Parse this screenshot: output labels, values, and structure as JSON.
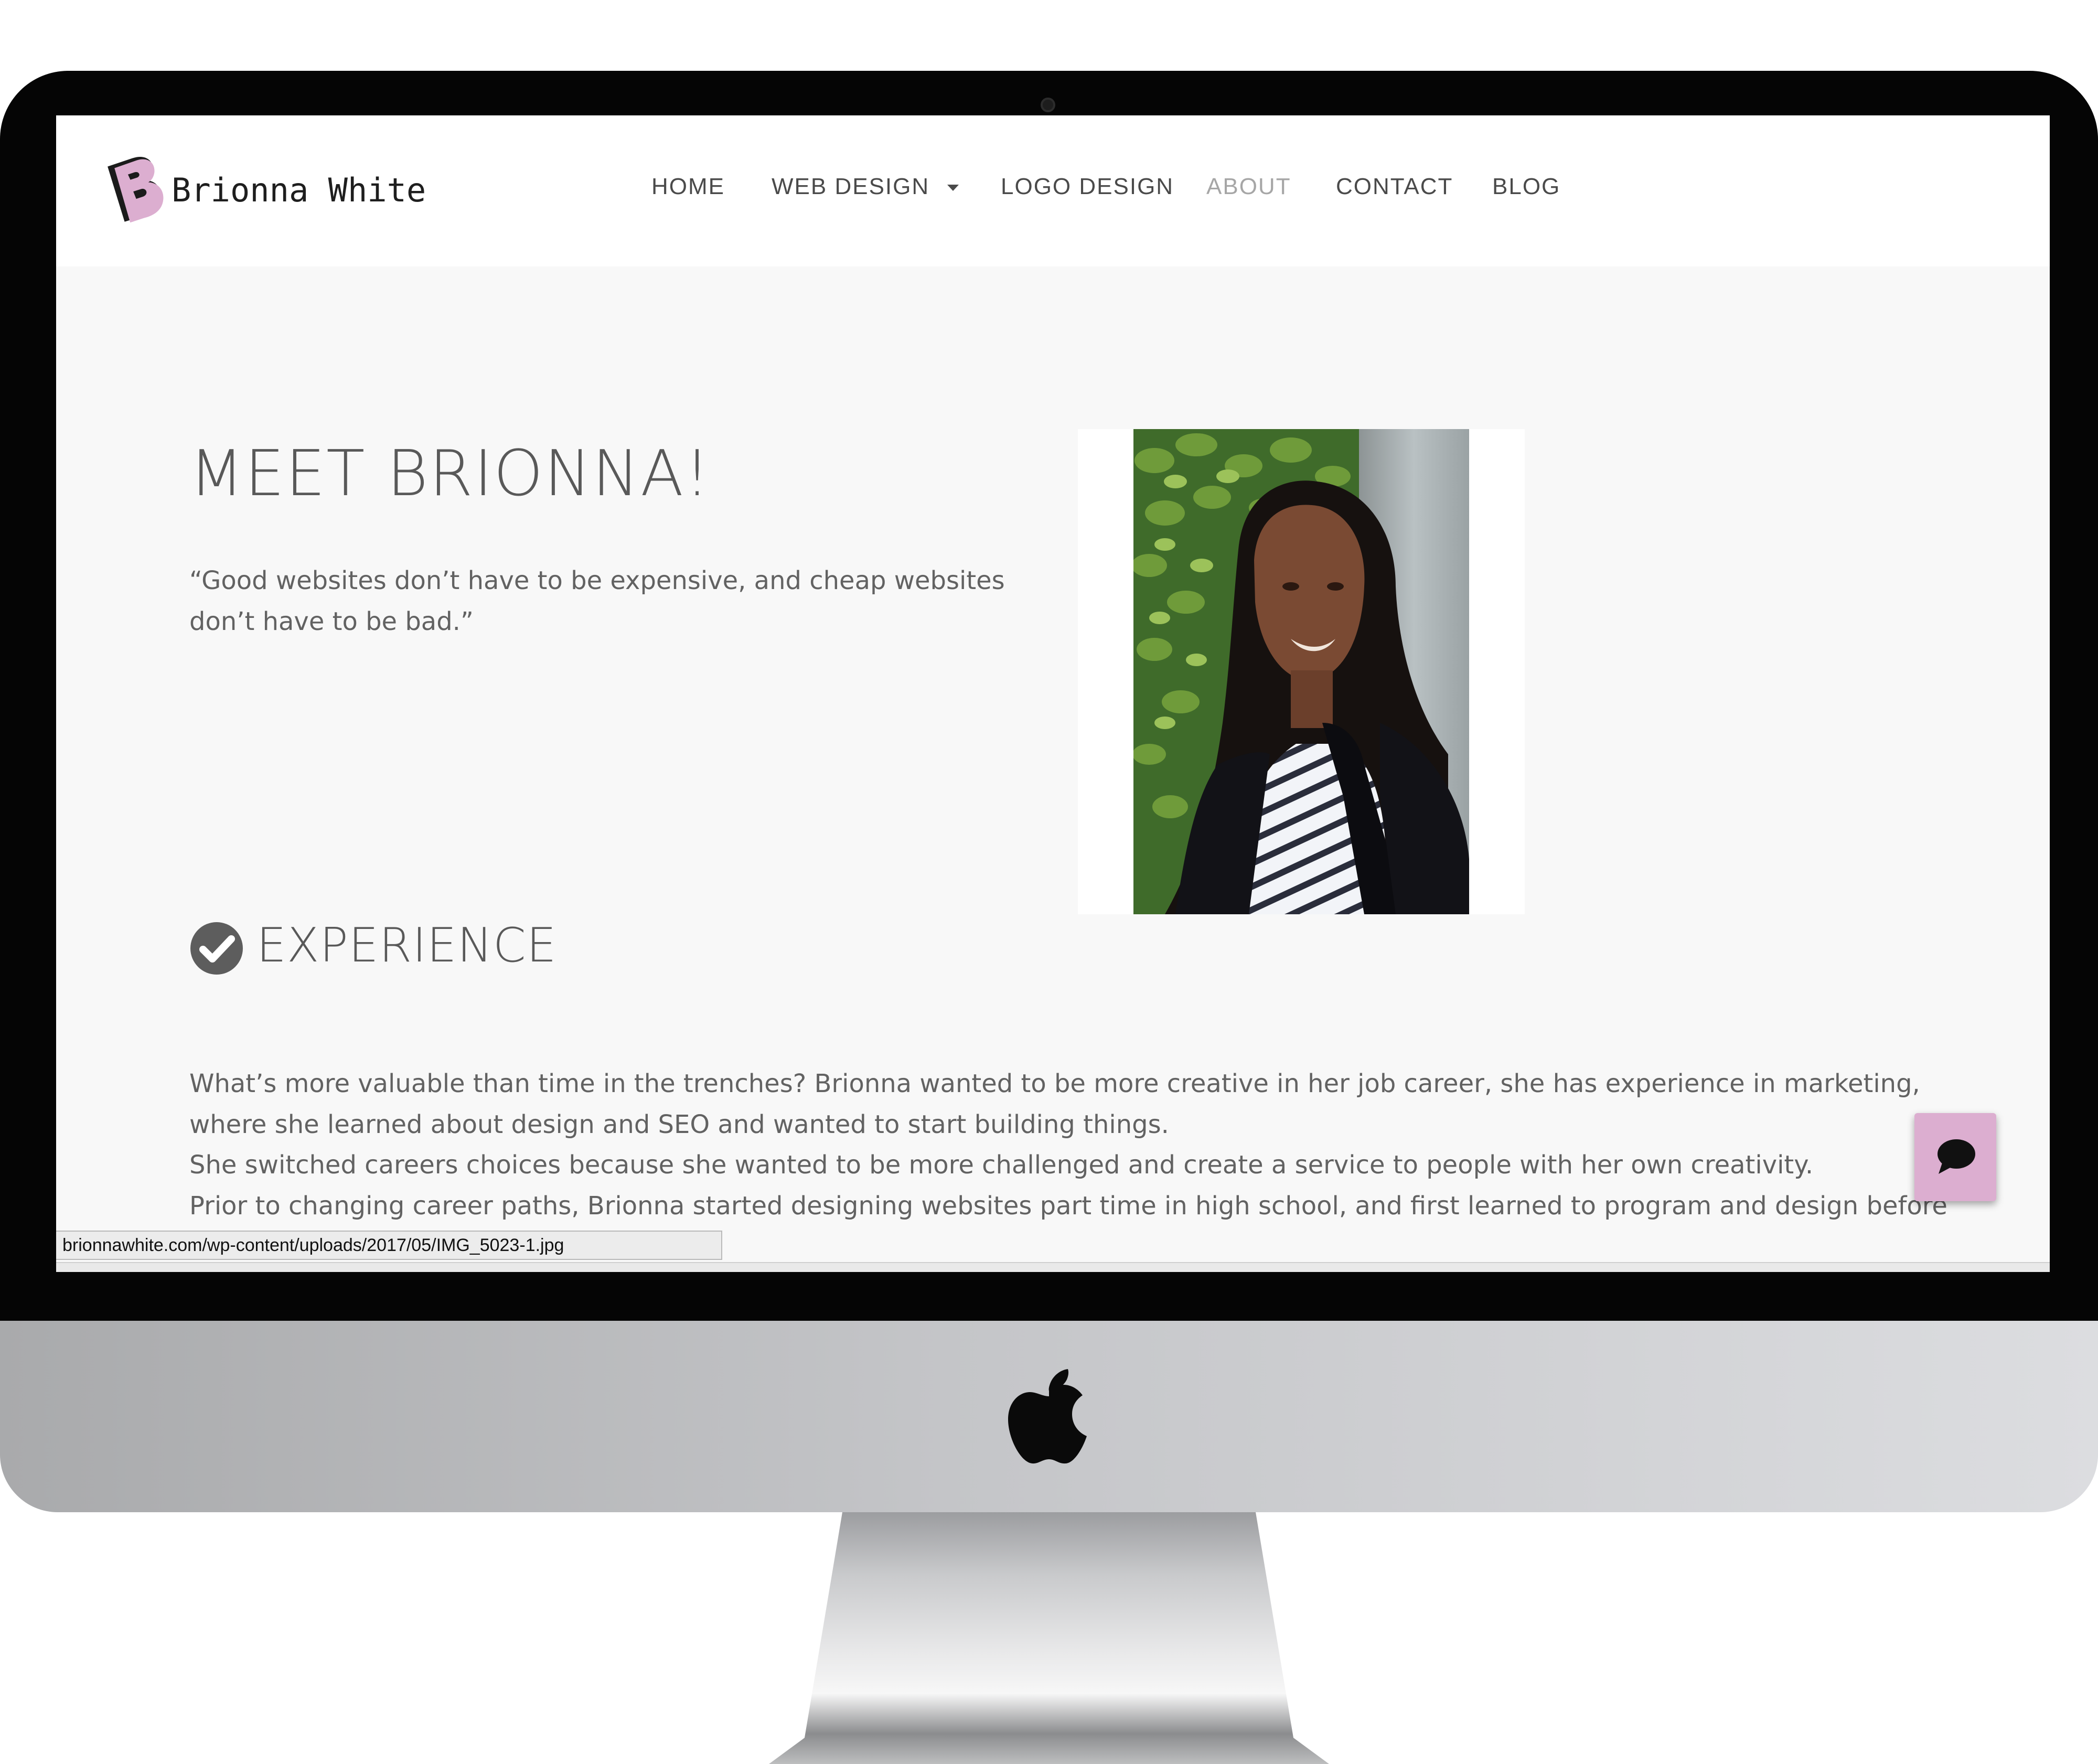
{
  "brand": {
    "name": "Brionna White",
    "logo_letter": "B",
    "accent_color": "#dcaed0"
  },
  "nav": {
    "items": [
      {
        "label": "HOME"
      },
      {
        "label": "WEB DESIGN"
      },
      {
        "label": "LOGO DESIGN"
      },
      {
        "label": "ABOUT"
      },
      {
        "label": "CONTACT"
      },
      {
        "label": "BLOG"
      }
    ],
    "active": "ABOUT"
  },
  "hero": {
    "title": "MEET BRIONNA!",
    "quote_line1": "“Good websites don’t have to be expensive, and cheap websites",
    "quote_line2": "don’t have to be bad.”"
  },
  "experience": {
    "heading": "EXPERIENCE",
    "icon": "check-circle-icon",
    "lines": [
      "What’s more valuable than time in the trenches? Brionna wanted to be more creative in her job career, she has experience in marketing,",
      "where she learned about design and SEO and wanted to start building things.",
      "She switched careers choices because she wanted to be more challenged and create a service to people with her own creativity.",
      "Prior to changing career paths, Brionna started designing websites part time in high school, and first learned to program and design before"
    ]
  },
  "chat": {
    "icon": "chat-bubble-icon"
  },
  "status_bar": {
    "url": "brionnawhite.com/wp-content/uploads/2017/05/IMG_5023-1.jpg"
  },
  "device": {
    "logo": "apple-logo"
  }
}
